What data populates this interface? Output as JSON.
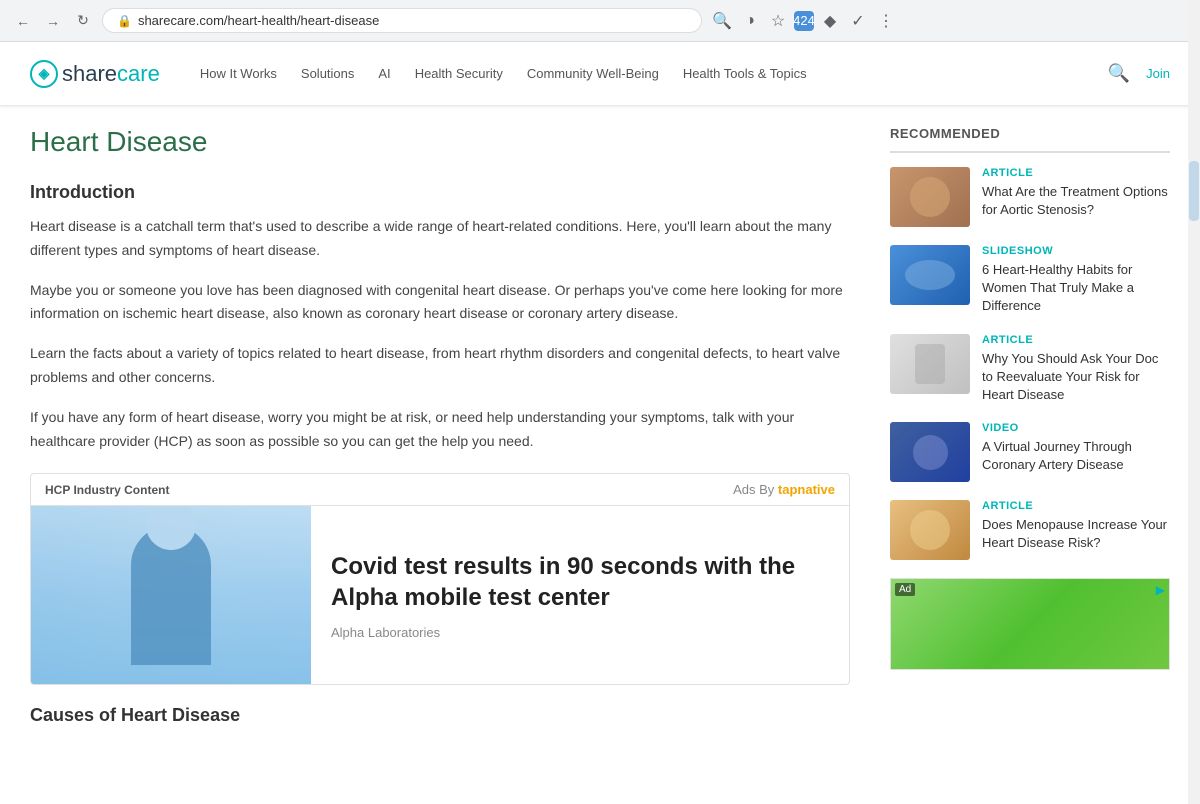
{
  "browser": {
    "url": "sharecare.com/heart-health/heart-disease",
    "back_tooltip": "Back",
    "forward_tooltip": "Forward",
    "refresh_tooltip": "Refresh"
  },
  "nav": {
    "logo_text": "sharecare",
    "links": [
      {
        "label": "How It Works",
        "id": "how-it-works"
      },
      {
        "label": "Solutions",
        "id": "solutions"
      },
      {
        "label": "AI",
        "id": "ai"
      },
      {
        "label": "Health Security",
        "id": "health-security"
      },
      {
        "label": "Community Well-Being",
        "id": "community-well-being"
      },
      {
        "label": "Health Tools & Topics",
        "id": "health-tools-topics"
      }
    ],
    "join_label": "Join"
  },
  "page": {
    "title": "Heart Disease",
    "intro_heading": "Introduction",
    "paragraphs": [
      "Heart disease is a catchall term that's used to describe a wide range of heart-related conditions. Here, you'll learn about the many different types and symptoms of heart disease.",
      "Maybe you or someone you love has been diagnosed with congenital heart disease. Or perhaps you've come here looking for more information on ischemic heart disease, also known as coronary heart disease or coronary artery disease.",
      "Learn the facts about a variety of topics related to heart disease, from heart rhythm disorders and congenital defects, to heart valve problems and other concerns.",
      "If you have any form of heart disease, worry you might be at risk, or need help understanding your symptoms, talk with your healthcare provider (HCP) as soon as possible so you can get the help you need."
    ],
    "causes_heading": "Causes of Heart Disease"
  },
  "ad": {
    "label": "HCP Industry Content",
    "ads_by": "Ads By",
    "tapnative": "tapnative",
    "headline": "Covid test results in 90 seconds with the Alpha mobile test center",
    "advertiser": "Alpha Laboratories"
  },
  "sidebar": {
    "recommended_title": "RECOMMENDED",
    "items": [
      {
        "type": "ARTICLE",
        "title": "What Are the Treatment Options for Aortic Stenosis?",
        "img_class": "rec-img-1"
      },
      {
        "type": "SLIDESHOW",
        "title": "6 Heart-Healthy Habits for Women That Truly Make a Difference",
        "img_class": "rec-img-2"
      },
      {
        "type": "ARTICLE",
        "title": "Why You Should Ask Your Doc to Reevaluate Your Risk for Heart Disease",
        "img_class": "rec-img-3"
      },
      {
        "type": "VIDEO",
        "title": "A Virtual Journey Through Coronary Artery Disease",
        "img_class": "rec-img-4"
      },
      {
        "type": "ARTICLE",
        "title": "Does Menopause Increase Your Heart Disease Risk?",
        "img_class": "rec-img-5"
      }
    ],
    "ad_badge": "Ad"
  },
  "colors": {
    "brand_teal": "#00b5b8",
    "page_title_green": "#2c6e49"
  }
}
